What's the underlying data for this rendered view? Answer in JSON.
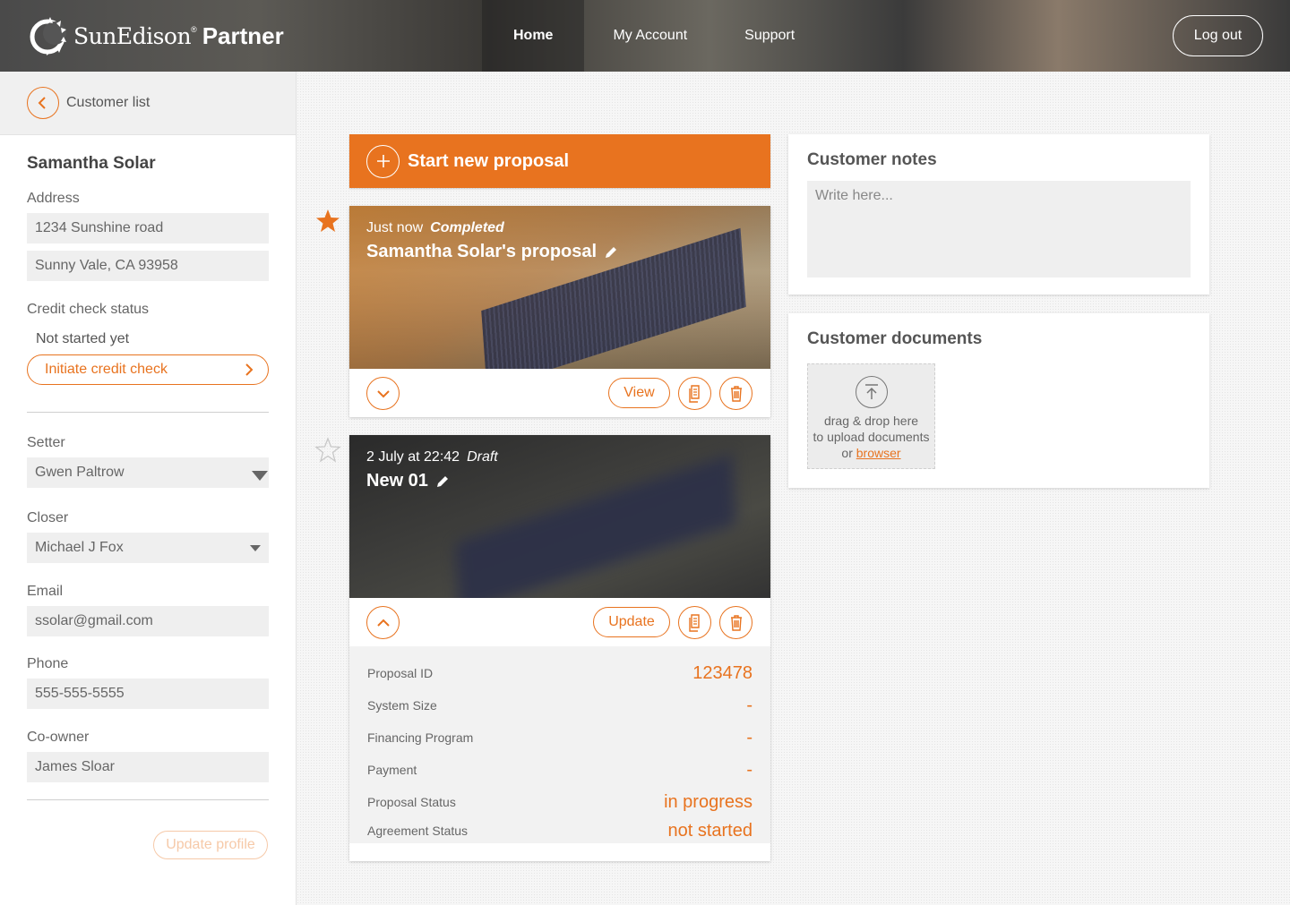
{
  "brand": {
    "name": "SunEdison",
    "registered": "®",
    "suffix": "Partner"
  },
  "nav": {
    "items": [
      {
        "label": "Home",
        "active": true
      },
      {
        "label": "My Account",
        "active": false
      },
      {
        "label": "Support",
        "active": false
      }
    ],
    "logout": "Log out"
  },
  "sidebar": {
    "back_label": "Customer list",
    "customer_name": "Samantha Solar",
    "address_label": "Address",
    "address_line1": "1234 Sunshine road",
    "address_line2": "Sunny Vale, CA 93958",
    "credit_label": "Credit check status",
    "credit_status": "Not started yet",
    "credit_button": "Initiate credit check",
    "setter_label": "Setter",
    "setter_value": "Gwen Paltrow",
    "closer_label": "Closer",
    "closer_value": "Michael J Fox",
    "email_label": "Email",
    "email_value": "ssolar@gmail.com",
    "phone_label": "Phone",
    "phone_value": "555-555-5555",
    "coowner_label": "Co-owner",
    "coowner_value": "James Sloar",
    "update_button": "Update profile"
  },
  "main": {
    "start_proposal": "Start new proposal",
    "proposals": [
      {
        "time": "Just now",
        "status": "Completed",
        "title": "Samantha Solar's proposal",
        "starred": true,
        "action": "View",
        "expanded": false
      },
      {
        "time": "2 July at 22:42",
        "status": "Draft",
        "title": "New 01",
        "starred": false,
        "action": "Update",
        "expanded": true,
        "details": [
          {
            "label": "Proposal ID",
            "value": "123478"
          },
          {
            "label": "System Size",
            "value": "-"
          },
          {
            "label": "Financing Program",
            "value": "-"
          },
          {
            "label": "Payment",
            "value": "-"
          },
          {
            "label": "Proposal Status",
            "value": "in progress"
          },
          {
            "label": "Agreement Status",
            "value": "not started"
          }
        ]
      }
    ]
  },
  "notes": {
    "title": "Customer notes",
    "placeholder": "Write here..."
  },
  "documents": {
    "title": "Customer documents",
    "line1": "drag & drop here",
    "line2": "to upload documents",
    "line3": "or",
    "link": "browser"
  },
  "colors": {
    "accent": "#e8731f",
    "field_bg": "#efefef"
  },
  "icons": [
    "logo-icon",
    "chevron-left-icon",
    "chevron-right-icon",
    "caret-down-icon",
    "plus-icon",
    "star-icon",
    "pencil-icon",
    "chevron-down-icon",
    "chevron-up-icon",
    "document-icon",
    "trash-icon",
    "upload-icon"
  ]
}
